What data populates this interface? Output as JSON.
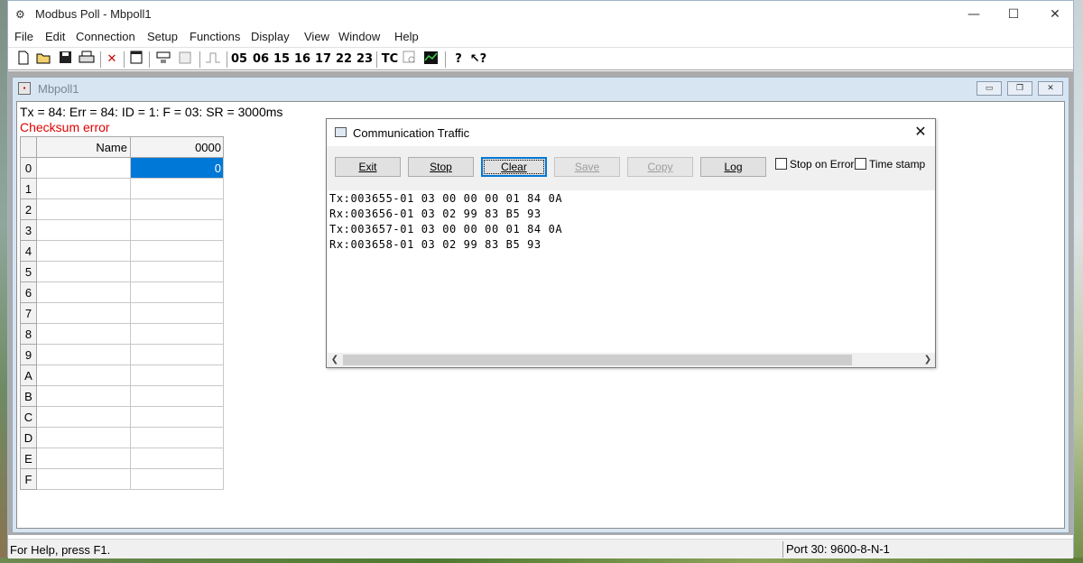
{
  "app": {
    "title": "Modbus Poll - Mbpoll1"
  },
  "window_controls": {
    "minimize": "—",
    "maximize": "☐",
    "close": "✕"
  },
  "menu": [
    "File",
    "Edit",
    "Connection",
    "Setup",
    "Functions",
    "Display",
    "View",
    "Window",
    "Help"
  ],
  "toolbar": {
    "function_codes": [
      "05",
      "06",
      "15",
      "16",
      "17",
      "22",
      "23"
    ],
    "tc_label": "TC",
    "icons": [
      "new-icon",
      "open-icon",
      "save-icon",
      "print-icon",
      "disconnect-icon",
      "window-icon",
      "read-write-icon",
      "print-preview-icon",
      "pulse-icon",
      "test-center-icon",
      "traffic-icon",
      "chart-icon",
      "help-icon",
      "context-help-icon"
    ]
  },
  "child_window": {
    "title": "Mbpoll1",
    "status_line": "Tx = 84: Err = 84: ID = 1: F = 03: SR = 3000ms",
    "error_line": "Checksum error",
    "table": {
      "headers": {
        "name": "Name",
        "address": "0000"
      },
      "rows": [
        {
          "label": "0",
          "name": "",
          "value": "0",
          "selected": true
        },
        {
          "label": "1",
          "name": "",
          "value": ""
        },
        {
          "label": "2",
          "name": "",
          "value": ""
        },
        {
          "label": "3",
          "name": "",
          "value": ""
        },
        {
          "label": "4",
          "name": "",
          "value": ""
        },
        {
          "label": "5",
          "name": "",
          "value": ""
        },
        {
          "label": "6",
          "name": "",
          "value": ""
        },
        {
          "label": "7",
          "name": "",
          "value": ""
        },
        {
          "label": "8",
          "name": "",
          "value": ""
        },
        {
          "label": "9",
          "name": "",
          "value": ""
        },
        {
          "label": "A",
          "name": "",
          "value": ""
        },
        {
          "label": "B",
          "name": "",
          "value": ""
        },
        {
          "label": "C",
          "name": "",
          "value": ""
        },
        {
          "label": "D",
          "name": "",
          "value": ""
        },
        {
          "label": "E",
          "name": "",
          "value": ""
        },
        {
          "label": "F",
          "name": "",
          "value": ""
        }
      ]
    }
  },
  "dialog": {
    "title": "Communication Traffic",
    "buttons": {
      "exit": "Exit",
      "stop": "Stop",
      "clear": "Clear",
      "save": "Save",
      "copy": "Copy",
      "log": "Log"
    },
    "checkboxes": {
      "stop_on_error": "Stop on Error",
      "time_stamp": "Time stamp"
    },
    "log_lines": [
      "Tx:003655-01 03 00 00 00 01 84 0A",
      "Rx:003656-01 03 02 99 83 B5 93",
      "Tx:003657-01 03 00 00 00 01 84 0A",
      "Rx:003658-01 03 02 99 83 B5 93"
    ]
  },
  "statusbar": {
    "help": "For Help, press F1.",
    "port": "Port 30: 9600-8-N-1"
  }
}
